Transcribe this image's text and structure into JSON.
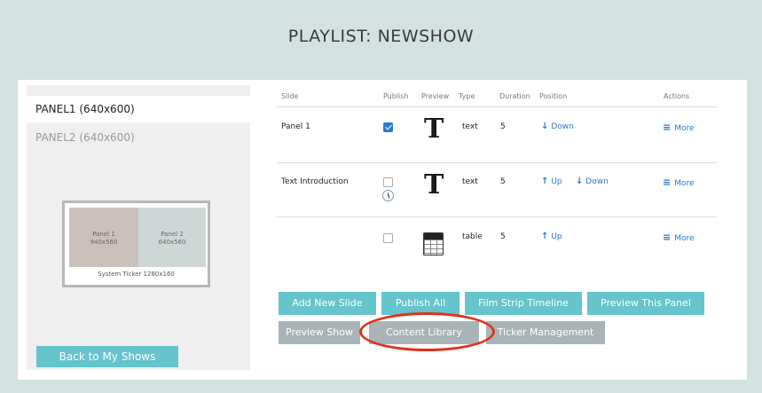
{
  "page": {
    "title": "PLAYLIST: NEWSHOW"
  },
  "panels": {
    "active": "PANEL1  (640x600)",
    "inactive": "PANEL2  (640x600)"
  },
  "layout_preview": {
    "panel1_name": "Panel 1",
    "panel1_size": "940x560",
    "panel2_name": "Panel 2",
    "panel2_size": "640x560",
    "ticker": "System Ticker 1280x160"
  },
  "back_button": "Back to My Shows",
  "table": {
    "headers": [
      "Slide",
      "Publish",
      "Preview",
      "Type",
      "Duration",
      "Position",
      "Actions"
    ],
    "rows": [
      {
        "slide": "Panel 1",
        "published": true,
        "scheduled": false,
        "preview_icon": "text-T-icon",
        "type": "text",
        "duration": "5",
        "up": "",
        "down": "Down",
        "action": "More"
      },
      {
        "slide": "Text Introduction",
        "published": false,
        "scheduled": true,
        "preview_icon": "text-T-icon",
        "type": "text",
        "duration": "5",
        "up": "Up",
        "down": "Down",
        "action": "More"
      },
      {
        "slide": "",
        "published": false,
        "scheduled": false,
        "preview_icon": "table-icon",
        "type": "table",
        "duration": "5",
        "up": "Up",
        "down": "",
        "action": "More"
      }
    ]
  },
  "buttons": {
    "add_new_slide": "Add New Slide",
    "publish_all": "Publish All",
    "film_strip_timeline": "Film Strip Timeline",
    "preview_this_panel": "Preview This Panel",
    "preview_show": "Preview Show",
    "content_library": "Content Library",
    "ticker_management": "Ticker Management"
  },
  "colors": {
    "background": "#d3e1e1",
    "accent_teal": "#65c4cc",
    "disabled_grey": "#a8b4b7",
    "link_blue": "#2a77d2",
    "highlight_red": "#e0311c"
  }
}
